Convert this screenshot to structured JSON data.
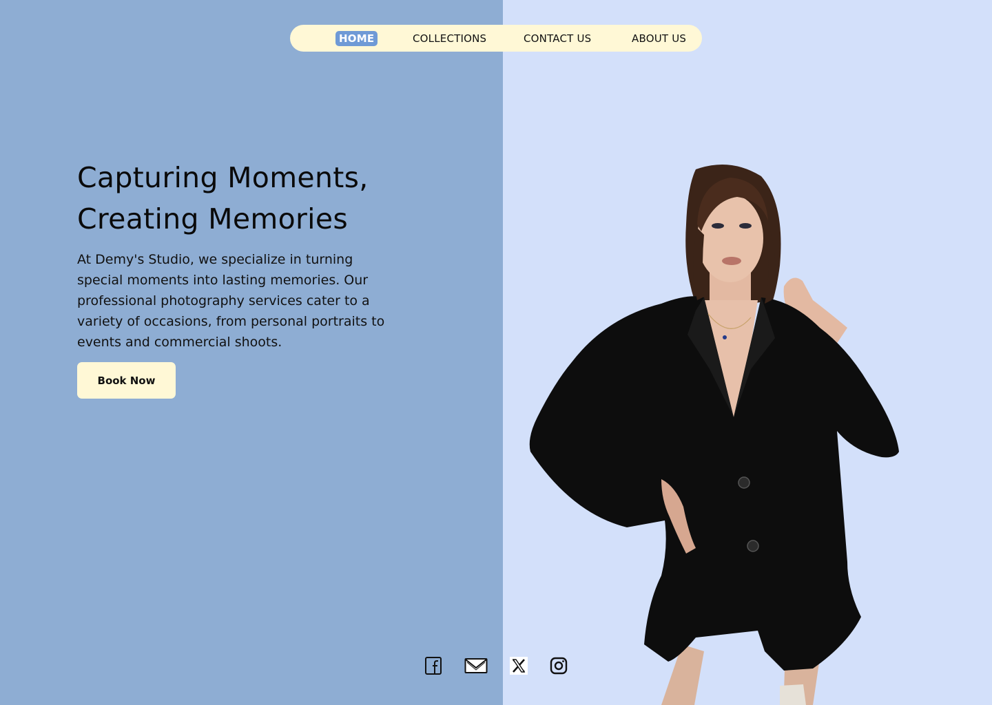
{
  "nav": {
    "items": [
      {
        "label": "HOME",
        "active": true
      },
      {
        "label": "COLLECTIONS",
        "active": false
      },
      {
        "label": "CONTACT US",
        "active": false
      },
      {
        "label": "ABOUT US",
        "active": false
      }
    ]
  },
  "hero": {
    "title_line1": "Capturing Moments,",
    "title_line2": "Creating Memories",
    "description": "At Demy's Studio, we specialize in turning special moments into lasting memories. Our professional photography services cater to a variety of occasions, from personal portraits to events and commercial shoots.",
    "cta_label": "Book Now"
  },
  "social": {
    "icons": [
      "facebook-icon",
      "mail-icon",
      "x-icon",
      "instagram-icon"
    ]
  },
  "colors": {
    "left_bg": "#8eadd3",
    "right_bg": "#d3e0fa",
    "nav_bg": "#fff8d6",
    "nav_active": "#6f9ad6",
    "button_bg": "#fff8d6"
  }
}
